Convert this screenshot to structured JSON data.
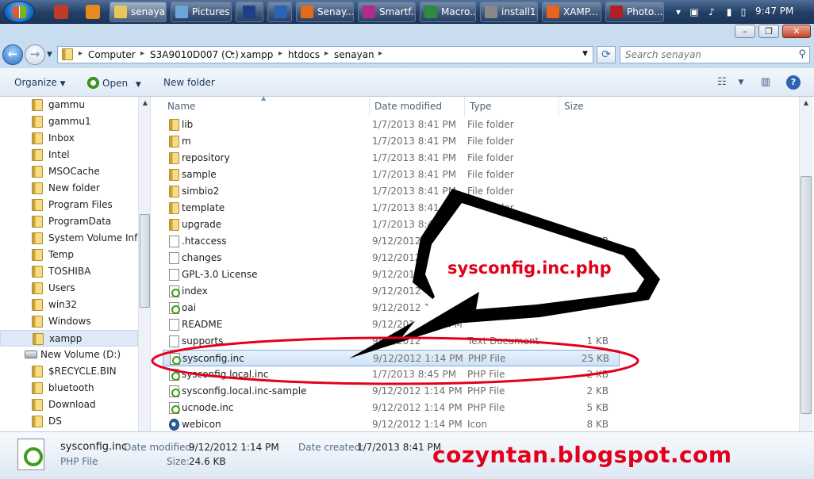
{
  "taskbar": {
    "buttons": [
      {
        "label": "senayan",
        "icon": "folder-icon"
      },
      {
        "label": "Pictures",
        "icon": "pictures-icon"
      },
      {
        "label": "Ps",
        "icon": "photoshop-icon"
      },
      {
        "label": "W",
        "icon": "word-icon"
      },
      {
        "label": "Senay...",
        "icon": "firefox-icon"
      },
      {
        "label": "Smartf...",
        "icon": "smartfren-icon"
      },
      {
        "label": "Macro...",
        "icon": "macromedia-icon"
      },
      {
        "label": "install1...",
        "icon": "installer-icon"
      },
      {
        "label": "XAMP...",
        "icon": "xampp-icon"
      },
      {
        "label": "Photo...",
        "icon": "photo-viewer-icon"
      }
    ],
    "clock": "9:47 PM"
  },
  "address": {
    "crumbs": [
      "Computer",
      "S3A9010D007 (C:)",
      "xampp",
      "htdocs",
      "senayan"
    ],
    "search_placeholder": "Search senayan"
  },
  "toolbar": {
    "organize": "Organize",
    "open": "Open",
    "new_folder": "New folder"
  },
  "nav": {
    "items": [
      {
        "label": "gammu",
        "kind": "folder"
      },
      {
        "label": "gammu1",
        "kind": "folder"
      },
      {
        "label": "Inbox",
        "kind": "folder"
      },
      {
        "label": "Intel",
        "kind": "folder"
      },
      {
        "label": "MSOCache",
        "kind": "folder"
      },
      {
        "label": "New folder",
        "kind": "folder"
      },
      {
        "label": "Program Files",
        "kind": "folder"
      },
      {
        "label": "ProgramData",
        "kind": "folder"
      },
      {
        "label": "System Volume Infor",
        "kind": "folder"
      },
      {
        "label": "Temp",
        "kind": "folder"
      },
      {
        "label": "TOSHIBA",
        "kind": "folder"
      },
      {
        "label": "Users",
        "kind": "folder"
      },
      {
        "label": "win32",
        "kind": "folder"
      },
      {
        "label": "Windows",
        "kind": "folder"
      },
      {
        "label": "xampp",
        "kind": "folder",
        "selected": true
      },
      {
        "label": "New Volume (D:)",
        "kind": "drive"
      },
      {
        "label": "$RECYCLE.BIN",
        "kind": "folder"
      },
      {
        "label": "bluetooth",
        "kind": "folder"
      },
      {
        "label": "Download",
        "kind": "folder"
      },
      {
        "label": "DS",
        "kind": "folder"
      }
    ]
  },
  "columns": {
    "name": "Name",
    "date": "Date modified",
    "type": "Type",
    "size": "Size"
  },
  "files": [
    {
      "name": "lib",
      "date": "1/7/2013 8:41 PM",
      "type": "File folder",
      "size": "",
      "icon": "folder"
    },
    {
      "name": "m",
      "date": "1/7/2013 8:41 PM",
      "type": "File folder",
      "size": "",
      "icon": "folder"
    },
    {
      "name": "repository",
      "date": "1/7/2013 8:41 PM",
      "type": "File folder",
      "size": "",
      "icon": "folder"
    },
    {
      "name": "sample",
      "date": "1/7/2013 8:41 PM",
      "type": "File folder",
      "size": "",
      "icon": "folder"
    },
    {
      "name": "simbio2",
      "date": "1/7/2013 8:41 PM",
      "type": "File folder",
      "size": "",
      "icon": "folder"
    },
    {
      "name": "template",
      "date": "1/7/2013 8:41 PM",
      "type": "File folder",
      "size": "",
      "icon": "folder"
    },
    {
      "name": "upgrade",
      "date": "1/7/2013 8:41 PM",
      "type": "File folder",
      "size": "",
      "icon": "folder"
    },
    {
      "name": ".htaccess",
      "date": "9/12/2012 1:14",
      "type": "",
      "size": "KB",
      "icon": "doc"
    },
    {
      "name": "changes",
      "date": "9/12/2012",
      "type": "",
      "size": "",
      "icon": "doc"
    },
    {
      "name": "GPL-3.0 License",
      "date": "9/12/2012",
      "type": "",
      "size": "",
      "icon": "doc"
    },
    {
      "name": "index",
      "date": "9/12/2012",
      "type": "",
      "size": "",
      "icon": "php"
    },
    {
      "name": "oai",
      "date": "9/12/2012 1:14 PM",
      "type": "",
      "size": "",
      "icon": "php"
    },
    {
      "name": "README",
      "date": "9/12/2012 1:14 PM",
      "type": "",
      "size": "",
      "icon": "doc"
    },
    {
      "name": "supports",
      "date": "9/12/2012",
      "type": "Text Document",
      "size": "1 KB",
      "icon": "doc"
    },
    {
      "name": "sysconfig.inc",
      "date": "9/12/2012 1:14 PM",
      "type": "PHP File",
      "size": "25 KB",
      "icon": "php",
      "selected": true
    },
    {
      "name": "sysconfig.local.inc",
      "date": "1/7/2013 8:45 PM",
      "type": "PHP File",
      "size": "2 KB",
      "icon": "php"
    },
    {
      "name": "sysconfig.local.inc-sample",
      "date": "9/12/2012 1:14 PM",
      "type": "PHP File",
      "size": "2 KB",
      "icon": "php"
    },
    {
      "name": "ucnode.inc",
      "date": "9/12/2012 1:14 PM",
      "type": "PHP File",
      "size": "5 KB",
      "icon": "php"
    },
    {
      "name": "webicon",
      "date": "9/12/2012 1:14 PM",
      "type": "Icon",
      "size": "8 KB",
      "icon": "icon"
    }
  ],
  "details": {
    "name": "sysconfig.inc",
    "type": "PHP File",
    "modified_label": "Date modified:",
    "modified": "9/12/2012 1:14 PM",
    "size_label": "Size:",
    "size": "24.6 KB",
    "created_label": "Date created:",
    "created": "1/7/2013 8:41 PM"
  },
  "annotation": {
    "callout": "sysconfig.inc.php",
    "watermark": "cozyntan.blogspot.com"
  },
  "colors": {
    "annotation_red": "#e3001b",
    "selection_blue": "#cfe2f7"
  }
}
